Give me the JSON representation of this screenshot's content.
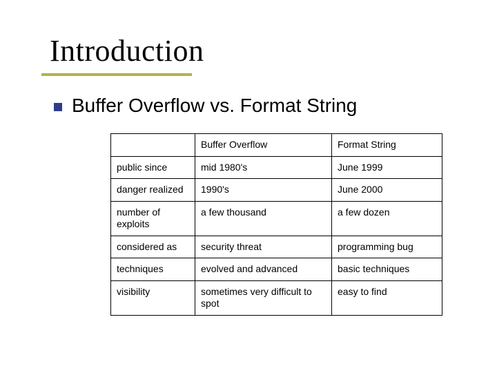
{
  "title": "Introduction",
  "subheading": "Buffer Overflow vs. Format String",
  "table": {
    "head": {
      "col0": "",
      "col1": "Buffer Overflow",
      "col2": "Format String"
    },
    "rows": [
      {
        "label": "public since",
        "col1": "mid 1980's",
        "col2": "June 1999"
      },
      {
        "label": "danger realized",
        "col1": "1990's",
        "col2": "June 2000"
      },
      {
        "label": "number of exploits",
        "col1": "a few thousand",
        "col2": "a few dozen"
      },
      {
        "label": "considered as",
        "col1": "security threat",
        "col2": "programming bug"
      },
      {
        "label": "techniques",
        "col1": "evolved and advanced",
        "col2": "basic techniques"
      },
      {
        "label": "visibility",
        "col1": "sometimes very difficult to spot",
        "col2": "easy to find"
      }
    ]
  }
}
